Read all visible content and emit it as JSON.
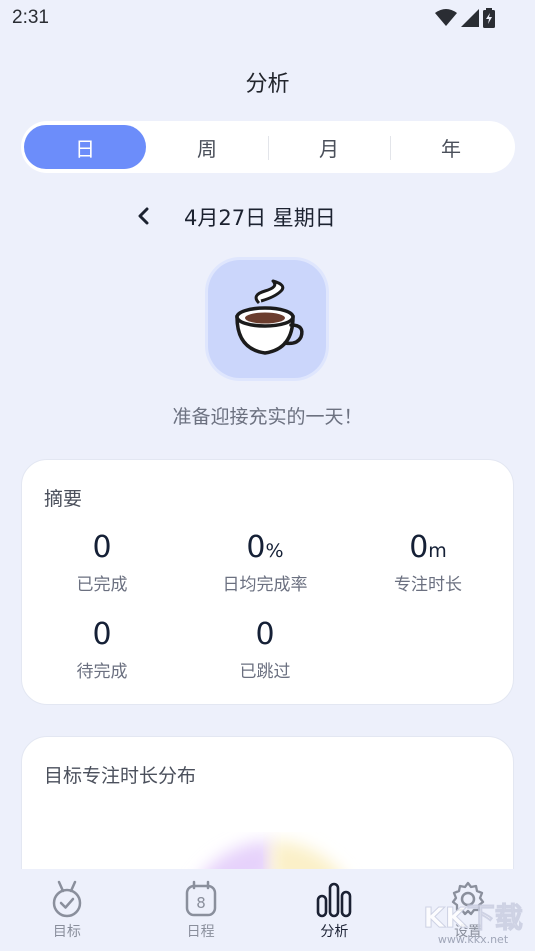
{
  "status": {
    "time": "2:31"
  },
  "header": {
    "title": "分析"
  },
  "period_tabs": [
    {
      "label": "日",
      "active": true
    },
    {
      "label": "周",
      "active": false
    },
    {
      "label": "月",
      "active": false
    },
    {
      "label": "年",
      "active": false
    }
  ],
  "date_nav": {
    "date_text": "4月27日 星期日"
  },
  "empty_state": {
    "icon": "coffee-cup-icon",
    "message": "准备迎接充实的一天！"
  },
  "summary": {
    "title": "摘要",
    "stats": [
      {
        "value": "0",
        "unit": "",
        "label": "已完成"
      },
      {
        "value": "0",
        "unit": "%",
        "label": "日均完成率"
      },
      {
        "value": "0",
        "unit": "m",
        "label": "专注时长"
      },
      {
        "value": "0",
        "unit": "",
        "label": "待完成"
      },
      {
        "value": "0",
        "unit": "",
        "label": "已跳过"
      }
    ]
  },
  "distribution": {
    "title": "目标专注时长分布"
  },
  "tab_bar": [
    {
      "label": "目标",
      "icon": "medal-check-icon",
      "active": false
    },
    {
      "label": "日程",
      "icon": "calendar-icon",
      "active": false
    },
    {
      "label": "分析",
      "icon": "bar-chart-icon",
      "active": true
    },
    {
      "label": "设置",
      "icon": "gear-icon",
      "active": false
    }
  ],
  "calendar_icon_number": "8",
  "watermark": {
    "text": "KK下载",
    "url_text": "www.kkx.net"
  },
  "colors": {
    "accent": "#6c8dfa",
    "background": "#edf0fb",
    "card": "#ffffff"
  }
}
